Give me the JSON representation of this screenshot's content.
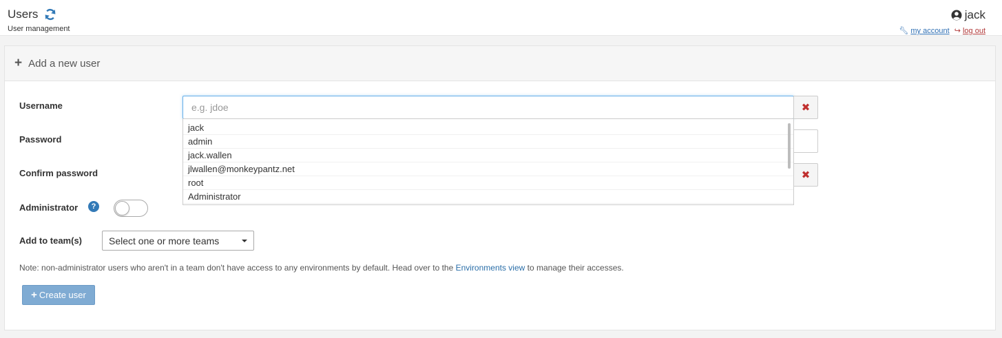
{
  "header": {
    "title": "Users",
    "subtitle": "User management",
    "username": "jack",
    "my_account": "my account",
    "log_out": "log out"
  },
  "panel": {
    "heading": "Add a new user"
  },
  "form": {
    "username_label": "Username",
    "username_placeholder": "e.g. jdoe",
    "password_label": "Password",
    "confirm_label": "Confirm password",
    "admin_label": "Administrator",
    "admin_enabled": false,
    "teams_label": "Add to team(s)",
    "teams_placeholder": "Select one or more teams",
    "note_prefix": "Note: non-administrator users who aren't in a team don't have access to any environments by default. Head over to the ",
    "note_link": "Environments view",
    "note_suffix": " to manage their accesses.",
    "create_label": "Create user"
  },
  "autocomplete": {
    "items": [
      "jack",
      "admin",
      "jack.wallen",
      "jlwallen@monkeypantz.net",
      "root",
      "Administrator"
    ]
  },
  "colors": {
    "accent": "#337ab7",
    "error": "#c0302f",
    "create_button": "#7fabd3"
  }
}
